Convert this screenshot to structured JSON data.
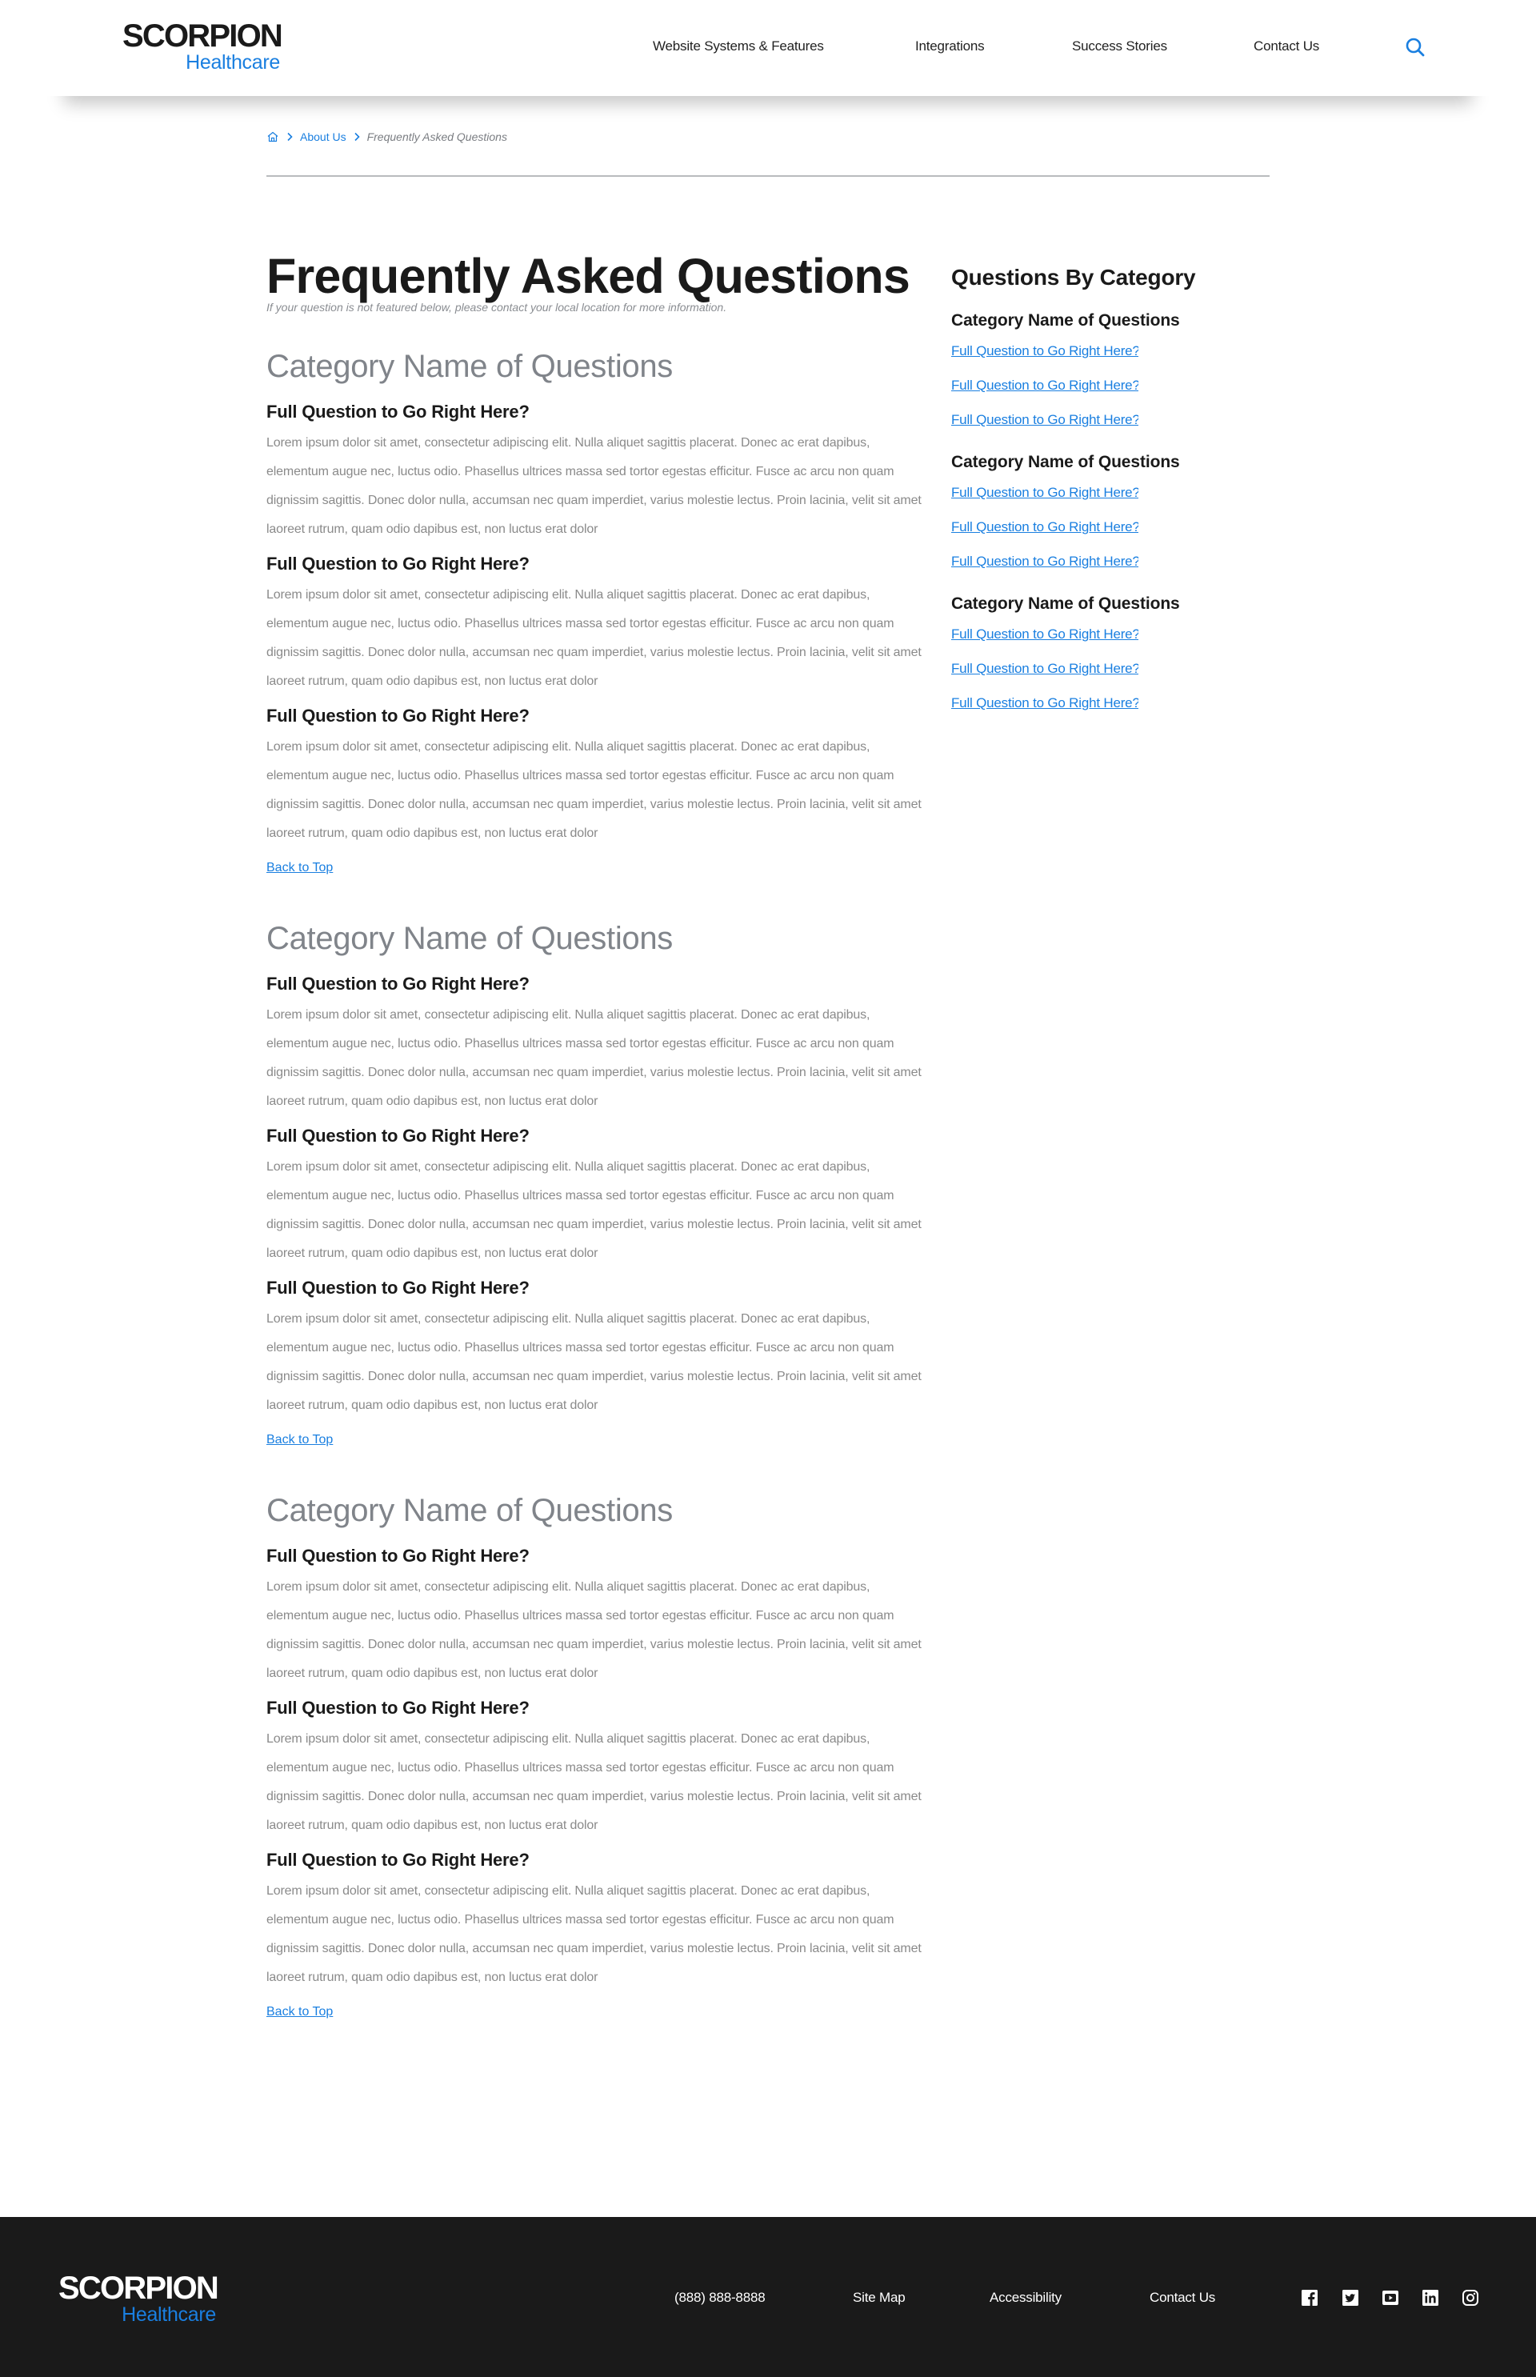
{
  "brand": {
    "name_top": "SCORPION",
    "name_bottom": "Healthcare",
    "accent_color": "#1a7fe0"
  },
  "nav": {
    "items": [
      {
        "label": "Website Systems & Features"
      },
      {
        "label": "Integrations"
      },
      {
        "label": "Success Stories"
      },
      {
        "label": "Contact Us"
      }
    ],
    "search_icon": "search-icon"
  },
  "breadcrumb": {
    "home_icon": "home-icon",
    "items": [
      {
        "label": "About Us"
      },
      {
        "label": "Frequently Asked Questions"
      }
    ]
  },
  "page": {
    "title": "Frequently Asked Questions",
    "subtitle": "If your question is not featured below, please contact your local location for more information."
  },
  "categories": [
    {
      "title": "Category Name of Questions",
      "questions": [
        {
          "q": "Full Question to Go Right Here?",
          "a": "Lorem ipsum dolor sit amet, consectetur adipiscing elit. Nulla aliquet sagittis placerat. Donec ac erat dapibus, elementum augue nec, luctus odio. Phasellus ultrices massa sed tortor egestas efficitur. Fusce ac arcu non quam dignissim sagittis. Donec dolor nulla, accumsan nec quam imperdiet, varius molestie lectus. Proin lacinia, velit sit amet laoreet rutrum, quam odio dapibus est, non luctus erat dolor"
        },
        {
          "q": "Full Question to Go Right Here?",
          "a": "Lorem ipsum dolor sit amet, consectetur adipiscing elit. Nulla aliquet sagittis placerat. Donec ac erat dapibus, elementum augue nec, luctus odio. Phasellus ultrices massa sed tortor egestas efficitur. Fusce ac arcu non quam dignissim sagittis. Donec dolor nulla, accumsan nec quam imperdiet, varius molestie lectus. Proin lacinia, velit sit amet laoreet rutrum, quam odio dapibus est, non luctus erat dolor"
        },
        {
          "q": "Full Question to Go Right Here?",
          "a": "Lorem ipsum dolor sit amet, consectetur adipiscing elit. Nulla aliquet sagittis placerat. Donec ac erat dapibus, elementum augue nec, luctus odio. Phasellus ultrices massa sed tortor egestas efficitur. Fusce ac arcu non quam dignissim sagittis. Donec dolor nulla, accumsan nec quam imperdiet, varius molestie lectus. Proin lacinia, velit sit amet laoreet rutrum, quam odio dapibus est, non luctus erat dolor"
        }
      ],
      "back_to_top": "Back to Top"
    },
    {
      "title": "Category Name of Questions",
      "questions": [
        {
          "q": "Full Question to Go Right Here?",
          "a": "Lorem ipsum dolor sit amet, consectetur adipiscing elit. Nulla aliquet sagittis placerat. Donec ac erat dapibus, elementum augue nec, luctus odio. Phasellus ultrices massa sed tortor egestas efficitur. Fusce ac arcu non quam dignissim sagittis. Donec dolor nulla, accumsan nec quam imperdiet, varius molestie lectus. Proin lacinia, velit sit amet laoreet rutrum, quam odio dapibus est, non luctus erat dolor"
        },
        {
          "q": "Full Question to Go Right Here?",
          "a": "Lorem ipsum dolor sit amet, consectetur adipiscing elit. Nulla aliquet sagittis placerat. Donec ac erat dapibus, elementum augue nec, luctus odio. Phasellus ultrices massa sed tortor egestas efficitur. Fusce ac arcu non quam dignissim sagittis. Donec dolor nulla, accumsan nec quam imperdiet, varius molestie lectus. Proin lacinia, velit sit amet laoreet rutrum, quam odio dapibus est, non luctus erat dolor"
        },
        {
          "q": "Full Question to Go Right Here?",
          "a": "Lorem ipsum dolor sit amet, consectetur adipiscing elit. Nulla aliquet sagittis placerat. Donec ac erat dapibus, elementum augue nec, luctus odio. Phasellus ultrices massa sed tortor egestas efficitur. Fusce ac arcu non quam dignissim sagittis. Donec dolor nulla, accumsan nec quam imperdiet, varius molestie lectus. Proin lacinia, velit sit amet laoreet rutrum, quam odio dapibus est, non luctus erat dolor"
        }
      ],
      "back_to_top": "Back to Top"
    },
    {
      "title": "Category Name of Questions",
      "questions": [
        {
          "q": "Full Question to Go Right Here?",
          "a": "Lorem ipsum dolor sit amet, consectetur adipiscing elit. Nulla aliquet sagittis placerat. Donec ac erat dapibus, elementum augue nec, luctus odio. Phasellus ultrices massa sed tortor egestas efficitur. Fusce ac arcu non quam dignissim sagittis. Donec dolor nulla, accumsan nec quam imperdiet, varius molestie lectus. Proin lacinia, velit sit amet laoreet rutrum, quam odio dapibus est, non luctus erat dolor"
        },
        {
          "q": "Full Question to Go Right Here?",
          "a": "Lorem ipsum dolor sit amet, consectetur adipiscing elit. Nulla aliquet sagittis placerat. Donec ac erat dapibus, elementum augue nec, luctus odio. Phasellus ultrices massa sed tortor egestas efficitur. Fusce ac arcu non quam dignissim sagittis. Donec dolor nulla, accumsan nec quam imperdiet, varius molestie lectus. Proin lacinia, velit sit amet laoreet rutrum, quam odio dapibus est, non luctus erat dolor"
        },
        {
          "q": "Full Question to Go Right Here?",
          "a": "Lorem ipsum dolor sit amet, consectetur adipiscing elit. Nulla aliquet sagittis placerat. Donec ac erat dapibus, elementum augue nec, luctus odio. Phasellus ultrices massa sed tortor egestas efficitur. Fusce ac arcu non quam dignissim sagittis. Donec dolor nulla, accumsan nec quam imperdiet, varius molestie lectus. Proin lacinia, velit sit amet laoreet rutrum, quam odio dapibus est, non luctus erat dolor"
        }
      ],
      "back_to_top": "Back to Top"
    }
  ],
  "sidebar": {
    "title": "Questions By Category",
    "categories": [
      {
        "title": "Category Name of Questions",
        "links": [
          "Full Question to Go Right Here?",
          "Full Question to Go Right Here?",
          "Full Question to Go Right Here?"
        ]
      },
      {
        "title": "Category Name of Questions",
        "links": [
          "Full Question to Go Right Here?",
          "Full Question to Go Right Here?",
          "Full Question to Go Right Here?"
        ]
      },
      {
        "title": "Category Name of Questions",
        "links": [
          "Full Question to Go Right Here?",
          "Full Question to Go Right Here?",
          "Full Question to Go Right Here?"
        ]
      }
    ]
  },
  "footer": {
    "phone": "(888) 888-8888",
    "links": [
      {
        "label": "Site Map"
      },
      {
        "label": "Accessibility"
      },
      {
        "label": "Contact Us"
      }
    ],
    "social": [
      {
        "icon": "facebook-icon"
      },
      {
        "icon": "twitter-icon"
      },
      {
        "icon": "youtube-icon"
      },
      {
        "icon": "linkedin-icon"
      },
      {
        "icon": "instagram-icon"
      }
    ]
  }
}
